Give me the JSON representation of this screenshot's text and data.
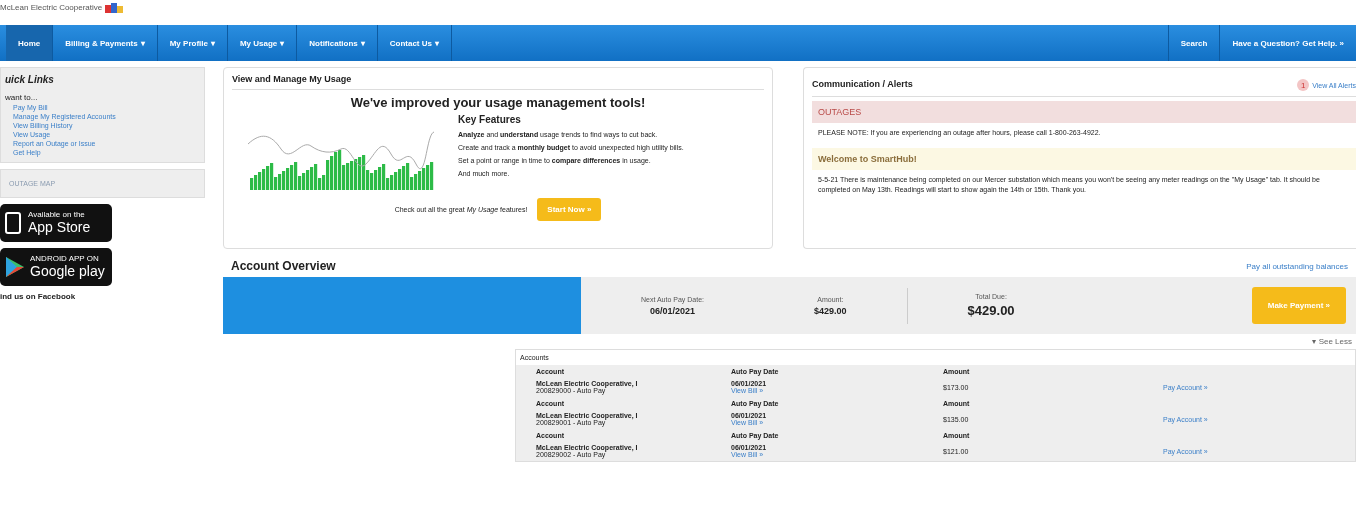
{
  "logo": {
    "text": "McLean Electric Cooperative"
  },
  "nav": {
    "items": [
      {
        "label": "Home",
        "selected": true,
        "dropdown": false
      },
      {
        "label": "Billing & Payments",
        "selected": false,
        "dropdown": true
      },
      {
        "label": "My Profile",
        "selected": false,
        "dropdown": true
      },
      {
        "label": "My Usage",
        "selected": false,
        "dropdown": true
      },
      {
        "label": "Notifications",
        "selected": false,
        "dropdown": true
      },
      {
        "label": "Contact Us",
        "selected": false,
        "dropdown": true
      }
    ],
    "caret": "▾",
    "right": [
      {
        "label": "Search"
      },
      {
        "label": "Have a Question? Get Help. »"
      }
    ]
  },
  "quick_links": {
    "title": "uick Links",
    "intro": "want to...",
    "links": [
      "Pay My Bill",
      "Manage My Registered Accounts",
      "View Billing History",
      "View Usage",
      "Report an Outage or Issue",
      "Get Help"
    ]
  },
  "outage_map": "OUTAGE MAP",
  "app_badges": [
    {
      "kind": "apple",
      "small": "Available on the",
      "big": "App Store"
    },
    {
      "kind": "google",
      "small": "ANDROID APP ON",
      "big": "Google play"
    }
  ],
  "facebook": "ind us on Facebook",
  "usage": {
    "title": "View and Manage My Usage",
    "headline": "We've improved your usage management tools!",
    "features_title": "Key Features",
    "features": [
      "**Analyze** and **understand** usage trends to find ways to cut back.",
      "Create and track a **monthly budget** to avoid unexpected high utility bills.",
      "Set a point or range in time to **compare differences** in usage.",
      "And much more."
    ],
    "cta_text": "Check out all the great *My Usage* features!",
    "cta_button": "Start Now »"
  },
  "alerts": {
    "title": "Communication / Alerts",
    "count": "1",
    "view_all": "View All Alerts",
    "items": [
      {
        "kind": "outage",
        "heading": "OUTAGES",
        "body": "PLEASE NOTE: If you are experiencing an outage after hours, please call 1-800-263-4922."
      },
      {
        "kind": "welcome",
        "heading": "Welcome to SmartHub!",
        "body": "5-5-21 There is maintenance being completed on our Mercer substation which means you won't be seeing any meter readings on the \"My Usage\" tab. It should be completed on May 13th. Readings will start to show again the 14th or 15th. Thank you."
      }
    ]
  },
  "overview": {
    "title": "Account Overview",
    "pay_all": "Pay all outstanding balances",
    "next_label": "Next Auto Pay Date:",
    "next_value": "06/01/2021",
    "amount_label": "Amount:",
    "amount_value": "$429.00",
    "total_label": "Total Due:",
    "total_value": "$429.00",
    "button": "Make Payment »",
    "see_less": "▾ See Less"
  },
  "accounts": {
    "title": "Accounts",
    "groups": [
      {
        "headers": [
          "Account",
          "Auto Pay Date",
          "Amount"
        ],
        "name": "McLean Electric Cooperative, I",
        "number": "200829000 - Auto Pay",
        "date": "06/01/2021",
        "view_bill": "View Bill »",
        "amount": "$173.00",
        "pay": "Pay Account »"
      },
      {
        "headers": [
          "Account",
          "Auto Pay Date",
          "Amount"
        ],
        "name": "McLean Electric Cooperative, I",
        "number": "200829001 - Auto Pay",
        "date": "06/01/2021",
        "view_bill": "View Bill »",
        "amount": "$135.00",
        "pay": "Pay Account »"
      },
      {
        "headers": [
          "Account",
          "Auto Pay Date",
          "Amount"
        ],
        "name": "McLean Electric Cooperative, I",
        "number": "200829002 - Auto Pay",
        "date": "06/01/2021",
        "view_bill": "View Bill »",
        "amount": "$121.00",
        "pay": "Pay Account »"
      }
    ]
  }
}
